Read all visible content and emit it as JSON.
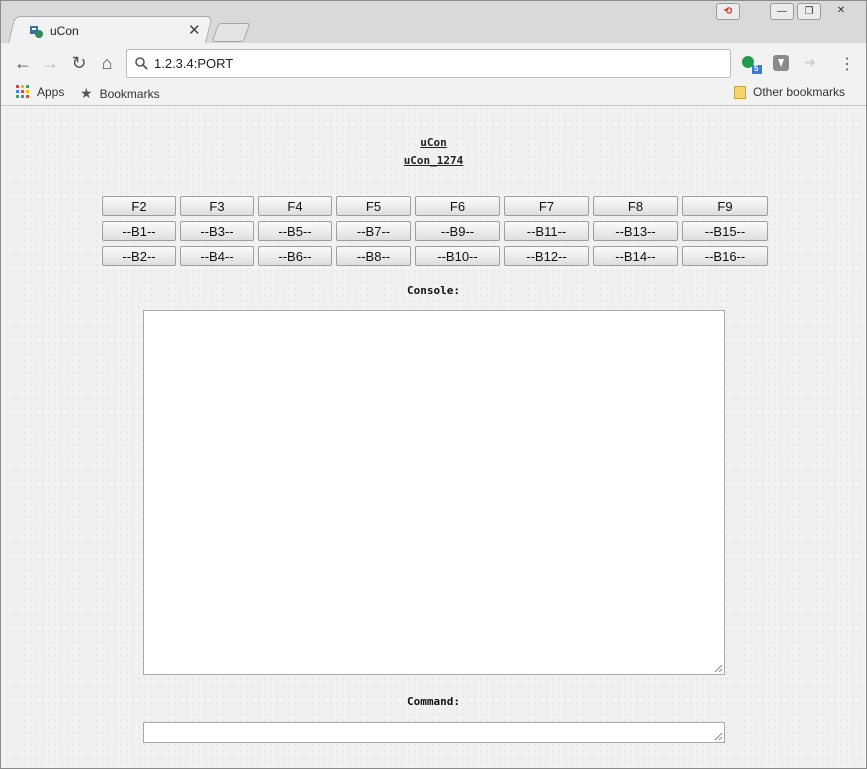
{
  "browser": {
    "tab_title": "uCon",
    "tab_close": "✕",
    "address": "1.2.3.4:PORT",
    "bookmarks_bar": {
      "apps": "Apps",
      "bookmarks": "Bookmarks",
      "other": "Other bookmarks"
    },
    "extension_badge": "5"
  },
  "page": {
    "title_link": "uCon",
    "subtitle_link": "uCon_1274",
    "function_keys": [
      "F2",
      "F3",
      "F4",
      "F5",
      "F6",
      "F7",
      "F8",
      "F9"
    ],
    "buttons_row1": [
      "--B1--",
      "--B3--",
      "--B5--",
      "--B7--",
      "--B9--",
      "--B11--",
      "--B13--",
      "--B15--"
    ],
    "buttons_row2": [
      "--B2--",
      "--B4--",
      "--B6--",
      "--B8--",
      "--B10--",
      "--B12--",
      "--B14--",
      "--B16--"
    ],
    "console_label": "Console:",
    "console_value": "",
    "command_label": "Command:",
    "command_value": ""
  }
}
